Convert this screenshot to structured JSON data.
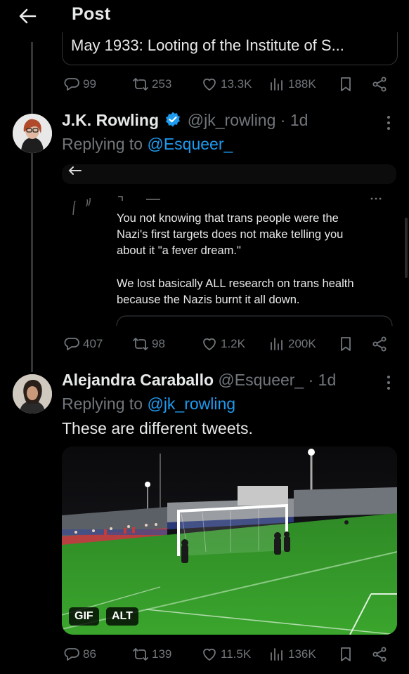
{
  "header": {
    "title": "Post"
  },
  "quoted_post": {
    "text": "May 1933: Looting of the Institute of S..."
  },
  "post1_stats": {
    "replies": "99",
    "reposts": "253",
    "likes": "13.3K",
    "views": "188K"
  },
  "rowling": {
    "name": "J.K. Rowling",
    "handle": "@jk_rowling",
    "time": "· 1d",
    "replying_prefix": "Replying to",
    "replying_to": "@Esqueer_",
    "embed_line1": "You not knowing that trans people were the",
    "embed_line2": "Nazi's first targets does not make telling you",
    "embed_line3": "about it \"a fever dream.\"",
    "embed_line4": "We lost basically ALL research on trans health",
    "embed_line5": "because the Nazis burnt it all down.",
    "stats": {
      "replies": "407",
      "reposts": "98",
      "likes": "1.2K",
      "views": "200K"
    }
  },
  "alejandra": {
    "name": "Alejandra Caraballo",
    "handle": "@Esqueer_",
    "time": "· 1d",
    "replying_prefix": "Replying to",
    "replying_to": "@jk_rowling",
    "text": "These are different tweets.",
    "gif_label": "GIF",
    "alt_label": "ALT",
    "stats": {
      "replies": "86",
      "reposts": "139",
      "likes": "11.5K",
      "views": "136K"
    }
  },
  "colors": {
    "background": "#000000",
    "text": "#e7e9ea",
    "muted": "#71767b",
    "link": "#1d9bf0",
    "verified": "#1d9bf0",
    "pitch": "#3aa52d"
  },
  "icons": [
    "back-arrow-icon",
    "reply-icon",
    "repost-icon",
    "like-icon",
    "views-icon",
    "bookmark-icon",
    "share-icon",
    "verified-icon",
    "more-icon"
  ]
}
